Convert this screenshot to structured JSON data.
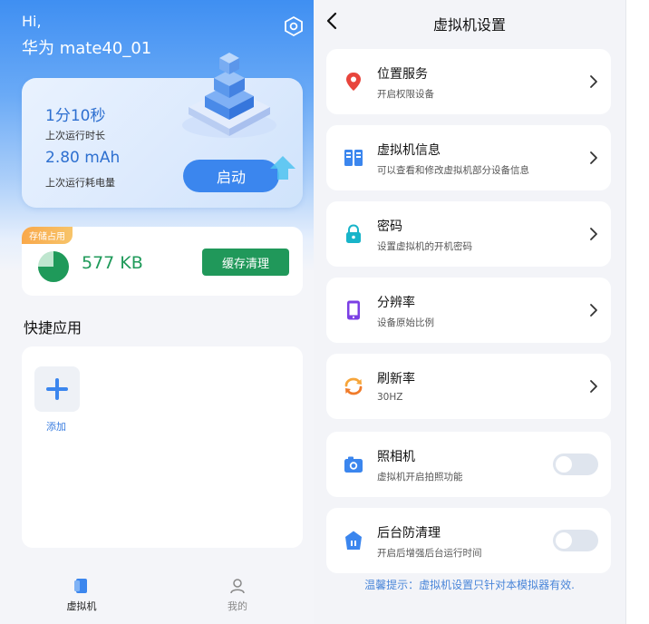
{
  "left": {
    "greeting": "Hi,",
    "device_name": "华为 mate40_01",
    "run_card": {
      "duration": "1分10秒",
      "duration_label": "上次运行时长",
      "power": "2.80 mAh",
      "power_label": "上次运行耗电量",
      "start_label": "启动"
    },
    "storage": {
      "badge": "存储占用",
      "value": "577 KB",
      "clean_label": "缓存清理",
      "usage_fraction": 0.75
    },
    "quick_apps": {
      "title": "快捷应用",
      "add_label": "添加"
    },
    "tabs": [
      {
        "label": "虚拟机",
        "icon": "vm-icon",
        "active": true
      },
      {
        "label": "我的",
        "icon": "user-icon",
        "active": false
      }
    ]
  },
  "right": {
    "title": "虚拟机设置",
    "rows": [
      {
        "title": "位置服务",
        "subtitle": "开启权限设备",
        "icon": "location-icon",
        "control": "chevron"
      },
      {
        "title": "虚拟机信息",
        "subtitle": "可以查看和修改虚拟机部分设备信息",
        "icon": "info-icon",
        "control": "chevron"
      },
      {
        "title": "密码",
        "subtitle": "设置虚拟机的开机密码",
        "icon": "lock-icon",
        "control": "chevron"
      },
      {
        "title": "分辨率",
        "subtitle": "设备原始比例",
        "icon": "phone-icon",
        "control": "chevron"
      },
      {
        "title": "刷新率",
        "subtitle": "30HZ",
        "icon": "refresh-icon",
        "control": "chevron"
      },
      {
        "title": "照相机",
        "subtitle": "虚拟机开启拍照功能",
        "icon": "camera-icon",
        "control": "toggle",
        "on": false
      },
      {
        "title": "后台防清理",
        "subtitle": "开启后增强后台运行时间",
        "icon": "shield-icon",
        "control": "toggle",
        "on": false
      }
    ],
    "tip": "温馨提示：虚拟机设置只针对本模拟器有效."
  },
  "colors": {
    "accent_blue": "#3b86ee",
    "green": "#20985a",
    "badge_orange": "#f9a84a"
  }
}
